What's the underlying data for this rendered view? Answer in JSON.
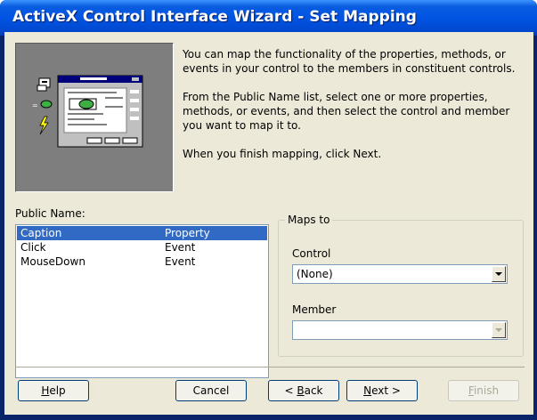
{
  "window": {
    "title": "ActiveX Control Interface Wizard - Set Mapping"
  },
  "description": {
    "para1": "You can map the functionality of the properties, methods, or events in your control to the members in constituent controls.",
    "para2": "From the Public Name list, select one or more properties, methods, or events, and then select the control and member you want to map it to.",
    "para3": "When you finish mapping, click Next."
  },
  "public_name": {
    "label": "Public Name:",
    "items": [
      {
        "name": "Caption",
        "type": "Property",
        "selected": true
      },
      {
        "name": "Click",
        "type": "Event",
        "selected": false
      },
      {
        "name": "MouseDown",
        "type": "Event",
        "selected": false
      }
    ]
  },
  "maps_to": {
    "label": "Maps to",
    "control": {
      "label": "Control",
      "value": "(None)"
    },
    "member": {
      "label": "Member",
      "value": "",
      "disabled": true
    }
  },
  "buttons": {
    "help": {
      "mnemonic": "H",
      "rest": "elp"
    },
    "cancel": {
      "label": "Cancel"
    },
    "back": {
      "prefix": "< ",
      "mnemonic": "B",
      "rest": "ack"
    },
    "next": {
      "mnemonic": "N",
      "rest": "ext >"
    },
    "finish": {
      "mnemonic": "F",
      "rest": "inish",
      "disabled": true
    }
  },
  "colors": {
    "title_bar": "#0054e3",
    "selection": "#316ac5",
    "dialog_bg": "#ece9d8"
  }
}
